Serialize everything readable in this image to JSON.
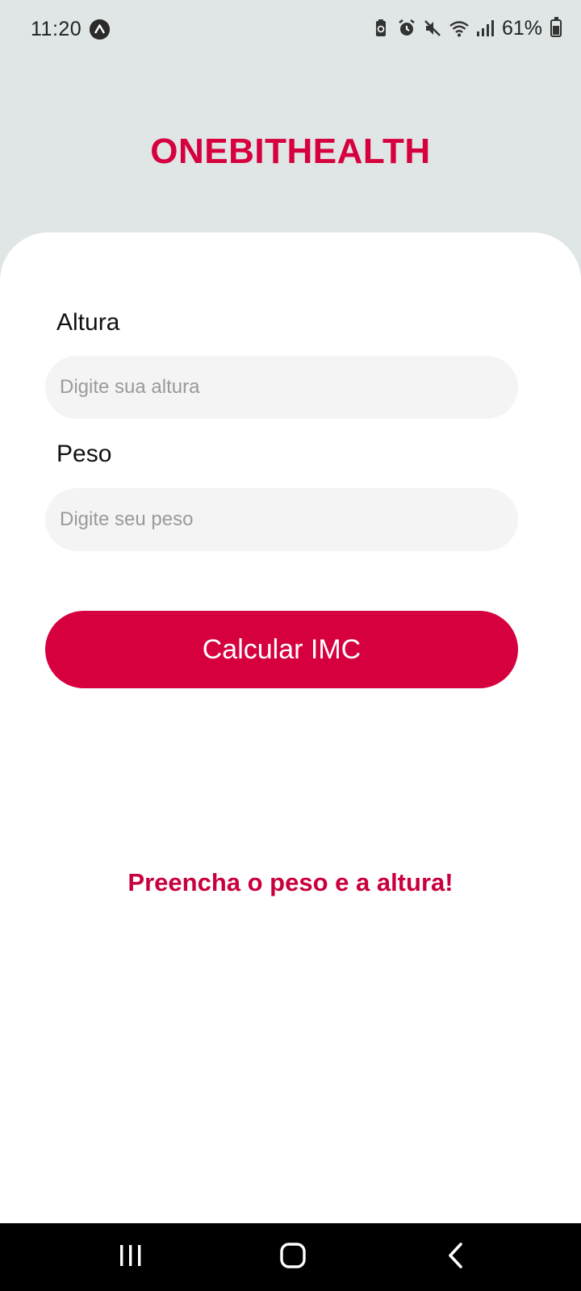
{
  "status_bar": {
    "time": "11:20",
    "battery_percent": "61%",
    "icons": [
      "expo-icon",
      "battery-saver-icon",
      "alarm-icon",
      "mute-icon",
      "wifi-icon",
      "signal-icon",
      "battery-icon"
    ]
  },
  "header": {
    "title": "ONEBITHEALTH"
  },
  "form": {
    "height_label": "Altura",
    "height_placeholder": "Digite sua altura",
    "height_value": "",
    "weight_label": "Peso",
    "weight_placeholder": "Digite seu peso",
    "weight_value": "",
    "submit_label": "Calcular IMC"
  },
  "result": {
    "message": "Preencha o peso e a altura!"
  },
  "colors": {
    "accent": "#d6003f",
    "background": "#e0e5e5",
    "card": "#ffffff",
    "input_bg": "#f4f4f4"
  },
  "nav_bar": {
    "icons": [
      "recents-icon",
      "home-icon",
      "back-icon"
    ]
  }
}
